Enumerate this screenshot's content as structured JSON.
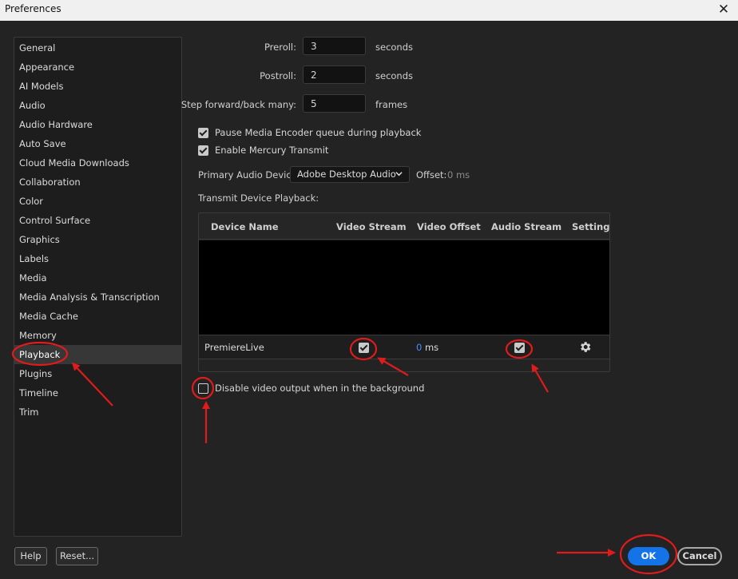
{
  "window": {
    "title": "Preferences",
    "close_glyph": "✕"
  },
  "sidebar": {
    "items": [
      {
        "label": "General"
      },
      {
        "label": "Appearance"
      },
      {
        "label": "AI Models"
      },
      {
        "label": "Audio"
      },
      {
        "label": "Audio Hardware"
      },
      {
        "label": "Auto Save"
      },
      {
        "label": "Cloud Media Downloads"
      },
      {
        "label": "Collaboration"
      },
      {
        "label": "Color"
      },
      {
        "label": "Control Surface"
      },
      {
        "label": "Graphics"
      },
      {
        "label": "Labels"
      },
      {
        "label": "Media"
      },
      {
        "label": "Media Analysis & Transcription"
      },
      {
        "label": "Media Cache"
      },
      {
        "label": "Memory"
      },
      {
        "label": "Playback"
      },
      {
        "label": "Plugins"
      },
      {
        "label": "Timeline"
      },
      {
        "label": "Trim"
      }
    ],
    "selected": "Playback"
  },
  "playback": {
    "preroll": {
      "label": "Preroll:",
      "value": "3",
      "unit": "seconds"
    },
    "postroll": {
      "label": "Postroll:",
      "value": "2",
      "unit": "seconds"
    },
    "step": {
      "label": "Step forward/back many:",
      "value": "5",
      "unit": "frames"
    },
    "pause_encoder": {
      "label": "Pause Media Encoder queue during playback",
      "checked": true
    },
    "mercury_transmit": {
      "label": "Enable Mercury Transmit",
      "checked": true
    },
    "primary_audio": {
      "label": "Primary Audio Device:",
      "value": "Adobe Desktop Audio"
    },
    "offset": {
      "label": "Offset:",
      "value": "0 ms"
    },
    "transmit_label": "Transmit Device Playback:",
    "table": {
      "headers": [
        "Device Name",
        "Video Stream",
        "Video Offset",
        "Audio Stream",
        "Settings"
      ],
      "rows": [
        {
          "device": "PremiereLive",
          "video_stream": true,
          "offset_value": "0",
          "offset_unit": "ms",
          "audio_stream": true
        }
      ]
    },
    "disable_bg": {
      "label": "Disable video output when in the background",
      "checked": false
    }
  },
  "footer": {
    "help": "Help",
    "reset": "Reset...",
    "ok": "OK",
    "cancel": "Cancel"
  },
  "icons": {
    "settings": "gear-icon",
    "dropdown": "chevron-down-icon",
    "close": "close-icon"
  },
  "colors": {
    "accent": "#1473e6",
    "annotation": "#e01b1b",
    "offset_number": "#4a8dff"
  }
}
